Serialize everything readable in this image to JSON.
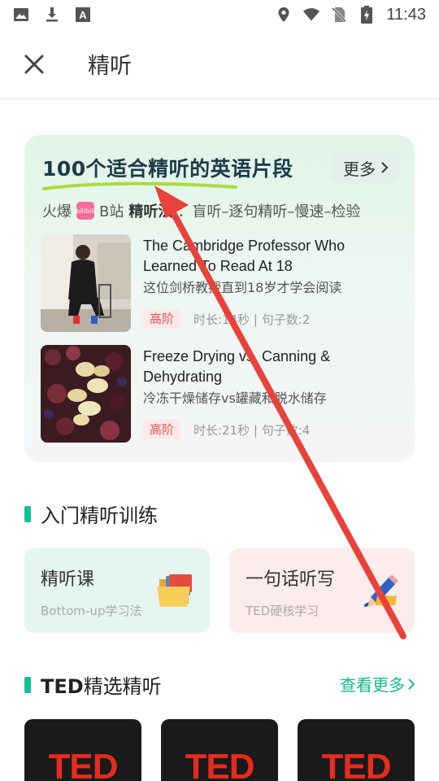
{
  "status_bar": {
    "time": "11:43",
    "left_icons": [
      "image-icon",
      "download-icon",
      "font-a-icon"
    ],
    "right_icons": [
      "location-icon",
      "wifi-icon",
      "no-sim-icon",
      "battery-charging-icon"
    ]
  },
  "header": {
    "title": "精听",
    "close_icon": "close-icon"
  },
  "hero": {
    "title": "100个适合精听的英语片段",
    "more_label": "更多",
    "sub_prefix": "火爆",
    "sub_badge": "bilibili",
    "sub_source": "B站",
    "sub_bold": "精听法",
    "sub_rest": "：盲听–逐句精听–慢速–检验",
    "items": [
      {
        "title": "The Cambridge Professor Who Learned To Read At 18",
        "subtitle": "这位剑桥教授直到18岁才学会阅读",
        "level": "高阶",
        "meta": "时长:14秒 | 句子数:2"
      },
      {
        "title": "Freeze Drying vs. Canning & Dehydrating",
        "subtitle": "冷冻干燥储存vs罐藏和脱水储存",
        "level": "高阶",
        "meta": "时长:21秒 | 句子数:4"
      }
    ]
  },
  "training": {
    "title": "入门精听训练",
    "cards": [
      {
        "title": "精听课",
        "subtitle": "Bottom-up学习法",
        "icon": "folder-icon"
      },
      {
        "title": "一句话听写",
        "subtitle": "TED硬核学习",
        "icon": "pencil-writing-icon"
      }
    ]
  },
  "ted": {
    "title_bold": "TED",
    "title_rest": "精选精听",
    "see_more": "查看更多",
    "cards": [
      "TED",
      "TED",
      "TED"
    ]
  },
  "colors": {
    "accent": "#13c196",
    "tag_red": "#e05555",
    "annotation_arrow": "#e8423a"
  }
}
